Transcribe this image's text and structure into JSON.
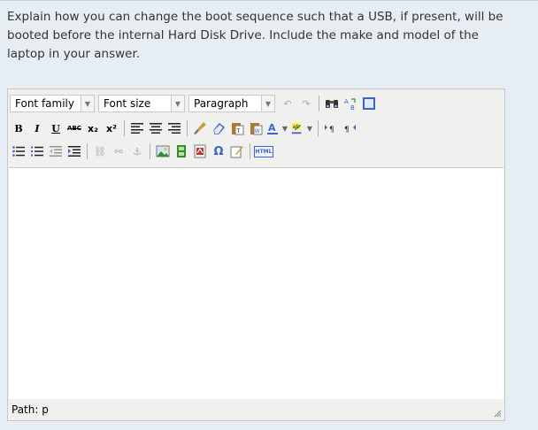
{
  "question": {
    "text": "Explain how you can change the boot sequence such that a USB, if present, will be booted before the internal Hard Disk Drive. Include the make and model of the laptop in your answer."
  },
  "editor": {
    "font_family": "Font family",
    "font_size": "Font size",
    "block_format": "Paragraph",
    "bold": "B",
    "italic": "I",
    "underline": "U",
    "strike": "ABC",
    "subscript": "x₂",
    "superscript": "x²",
    "html_label": "HTML",
    "status_path": "Path: p",
    "colors": {
      "accent_blue": "#3b63c9",
      "icon_green": "#3a8a2a"
    }
  }
}
